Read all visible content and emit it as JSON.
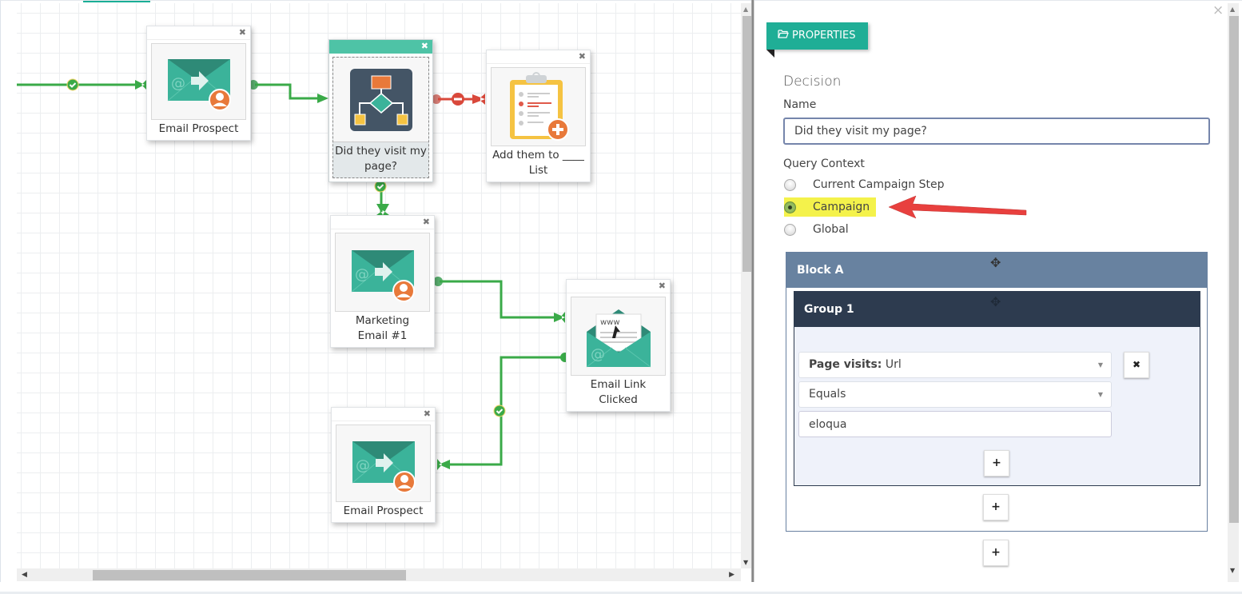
{
  "canvas": {
    "nodes": [
      {
        "id": "email-prospect-1",
        "label": "Email Prospect",
        "icon": "email-send-icon",
        "close": "✖"
      },
      {
        "id": "decision",
        "label": "Did they visit my page?",
        "icon": "decision-flowchart-icon",
        "close": "✖",
        "selected": true
      },
      {
        "id": "add-to-list",
        "label": "Add them to ____ List",
        "icon": "clipboard-add-icon",
        "close": "✖"
      },
      {
        "id": "marketing-email",
        "label": "Marketing Email #1",
        "icon": "email-send-icon",
        "close": "✖"
      },
      {
        "id": "email-link-clicked",
        "label": "Email Link Clicked",
        "icon": "email-link-icon",
        "close": "✖"
      },
      {
        "id": "email-prospect-2",
        "label": "Email Prospect",
        "icon": "email-send-icon",
        "close": "✖"
      }
    ],
    "colors": {
      "success_line": "#3aaa48",
      "fail_line": "#d9483b",
      "selected_header": "#4ec3a6",
      "email_teal": "#3bb39a",
      "email_flap": "#2e8a77",
      "avatar_orange": "#e8793a"
    }
  },
  "panel": {
    "ribbon_label": "PROPERTIES",
    "close": "×",
    "section_title": "Decision",
    "name_label": "Name",
    "name_value": "Did they visit my page?",
    "query_context_label": "Query Context",
    "query_context_options": [
      {
        "label": "Current Campaign Step",
        "checked": false
      },
      {
        "label": "Campaign",
        "checked": true
      },
      {
        "label": "Global",
        "checked": false
      }
    ],
    "block": {
      "title": "Block A",
      "group": {
        "title": "Group 1",
        "criteria": {
          "field_bold": "Page visits:",
          "field_value": " Url",
          "operator": "Equals",
          "value": "eloqua",
          "remove_label": "✖"
        },
        "add_label": "+"
      },
      "add_label": "+"
    },
    "add_block_label": "+",
    "colors": {
      "ribbon": "#1fae96",
      "block_header": "#6882a0",
      "group_header": "#2d3b4f",
      "highlight": "#f4f24b",
      "annotation_arrow": "#e8403e"
    }
  }
}
